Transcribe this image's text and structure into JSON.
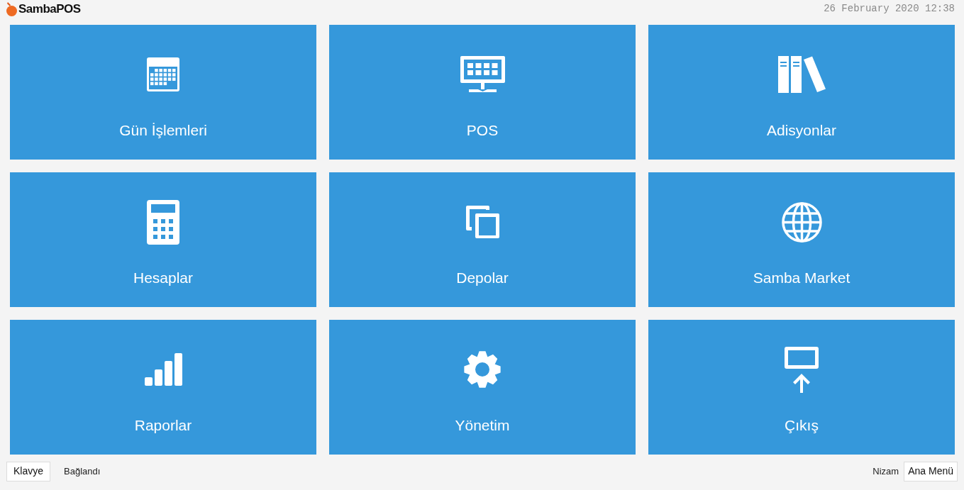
{
  "header": {
    "logo_text": "SambaPOS",
    "datetime": "26 February 2020 12:38"
  },
  "tiles": [
    {
      "label": "Gün İşlemleri"
    },
    {
      "label": "POS"
    },
    {
      "label": "Adisyonlar"
    },
    {
      "label": "Hesaplar"
    },
    {
      "label": "Depolar"
    },
    {
      "label": "Samba Market"
    },
    {
      "label": "Raporlar"
    },
    {
      "label": "Yönetim"
    },
    {
      "label": "Çıkış"
    }
  ],
  "footer": {
    "keyboard_button": "Klavye",
    "connection_status": "Bağlandı",
    "user_name": "Nizam",
    "main_menu_button": "Ana Menü"
  }
}
